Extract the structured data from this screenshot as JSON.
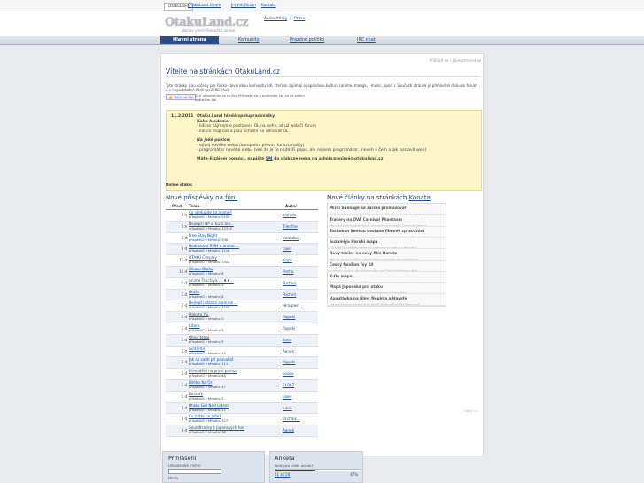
{
  "topbar": {
    "active_tab": "OtakuLand",
    "links": [
      "OtakuLand fórum",
      "Ji-rank fórum",
      "Kontakt"
    ]
  },
  "header": {
    "logo": "OtakuLand.cz",
    "tagline": "domov všech fanoušků anime",
    "links": [
      "Anime/tituly",
      "Otaku"
    ]
  },
  "nav": {
    "items": [
      "Hlavní strana",
      "Komunity",
      "Prazdné políčko",
      "IRC chat"
    ]
  },
  "toplinks": "Přihlásit se | Zaregistrovat se",
  "welcome": "Vítejte na stránkách OtakuLand.cz",
  "intro": "Tyto stránky jsou určeny pro česko-slovenskou komunitu lidí, kteří se zajímají o japonskou kulturu (anime, manga, j-music, apod.). Součástí stránek je přehledné diskusní fórum a v nepodstatné části také IRC chat.",
  "fb": {
    "button": "Tohle se líbí",
    "text": "110 uživatelům se to líbí. Přihlaste se a podívejte se, co se vašim přátelům líbí."
  },
  "notice": {
    "date": "11.2.2011",
    "heading": "Otaku.Land hledá spolupracovníky",
    "q1": "Koho hledáme:",
    "l1": [
      "- lidi se zájmem o postavení OL na nohy, ať už web či fórum",
      "- lidi co mají čas a jsou ochotní ho věnovat OL"
    ],
    "q2": "Na jaké pozice:",
    "l2": [
      "- vývoj nového webu (kompletní převod funkcionality)",
      "- programátor nového webu (vím že je to nejtěžší popis, ale nejsem programátor...nevím v čem a jak postavit web)"
    ],
    "closing_before": "Máte-li zájem pomoci, napište",
    "closing_link": "SM",
    "closing_after": "do diskuze nebo na admin@animé@otakuland.cz"
  },
  "online": "Online otaku:",
  "forum": {
    "title": "Nové příspěvky na",
    "title_link": "fóru",
    "headers": {
      "before": "Před",
      "topic": "Téma",
      "author": "Autor"
    },
    "rows": [
      {
        "n": "3 h",
        "t": "Co sledujete za anime?",
        "s": "příspěvků v tématu: 9200",
        "a": "zombie"
      },
      {
        "n": "5 h",
        "t": "Nejlepší OP & ED z ani...",
        "s": "příspěvků v tématu: 10746",
        "a": "Tiledfire"
      },
      {
        "n": "1 d",
        "t": "Free Stay Night",
        "s": "příspěvků v tématu: 936",
        "a": "Immalko"
      },
      {
        "n": "6 d",
        "t": "Hodnocení RMH a anime ...",
        "s": "příspěvků v tématu: 1216",
        "a": "pixel"
      },
      {
        "n": "11 d",
        "t": "OTAKU Cosplay",
        "s": "příspěvků v tématu: 1303",
        "a": "zippz"
      },
      {
        "n": "16 d",
        "t": "Hikaru Otaku",
        "s": "příspěvků v tématu: 6",
        "a": "Pocho"
      },
      {
        "n": "1 d",
        "t": "Anime Tsuchiya ... ♦♦...",
        "s": "příspěvků v tématu: 4",
        "a": "Pocheri"
      },
      {
        "n": "1 d",
        "t": "Otaže",
        "s": "příspěvků v tématu: 8",
        "a": "Pocheri"
      },
      {
        "n": "2 d",
        "t": "Nejlepší otázka o anime ...",
        "s": "příspěvků v tématu: 3700",
        "a": "Hiragaen"
      },
      {
        "n": "1 d",
        "t": "Makoto Yui",
        "s": "příspěvků v tématu: 0",
        "a": "Rapohi"
      },
      {
        "n": "1 d",
        "t": "Kitaro",
        "s": "příspěvků v tématu: 7",
        "a": "Rapohi"
      },
      {
        "n": "1 d",
        "t": "Otevi tema",
        "s": "příspěvků v tématu: 9",
        "a": "ilona"
      },
      {
        "n": "1 d",
        "t": "Gintama",
        "s": "příspěvků v tématu: 14",
        "a": "Aeneli"
      },
      {
        "n": "2 d",
        "t": "Jak se zaliti při pozvolně",
        "s": "příspěvků v tématu: 111",
        "a": "Rapohi"
      },
      {
        "n": "2 d",
        "t": "Převádění na první pomoc",
        "s": "příspěvků v tématu: 46",
        "a": "kosiru"
      },
      {
        "n": "1 d",
        "t": "Bílého Na Or",
        "s": "příspěvků v tématu: 47",
        "a": "El 007"
      },
      {
        "n": "1 d",
        "t": "Berserk",
        "s": "příspěvků v tématu: 3",
        "a": "pixel"
      },
      {
        "n": "3 d",
        "t": "Otaku Girl Nad Lidem",
        "s": "příspěvků v tématu: 11",
        "a": "Juera"
      },
      {
        "n": "4 d",
        "t": "Co máte na jídlo?",
        "s": "příspěvků v tématu: 3277",
        "a": "Orchais..."
      },
      {
        "n": "4 d",
        "t": "Soundtracky z japonských her",
        "s": "příspěvků v tématu: 38",
        "a": "Aeneli"
      }
    ]
  },
  "articles": {
    "title": "Nové články na stránkách",
    "title_link": "Konata",
    "items": [
      {
        "t": "Mirai Suenage se začíná promazovat",
        "e": "Pokud jste si i vy oblíbili postavu Mirai, známého maskot..."
      },
      {
        "t": "Trailery na OVA Carnival Phantasm",
        "e": "Na oficiálních stránkách pro anime projekt Carnival Phant..."
      },
      {
        "t": "Toshokan Sensou dostane filmové zpracování",
        "e": "Na čerstvém taktu od nakladatelství Hatsukawa Bunko, které..."
      },
      {
        "t": "Suzumiya Haruhi mapa",
        "e": "Co takhle udělat nějakou zajímavou kartu o Haruhi?..."
      },
      {
        "t": "Nový trailer na nový film Naruto",
        "e": "Jak už se asi tušíte, tento film navazuje na předchozí..."
      },
      {
        "t": "Český fandom foy 10",
        "e": "V rámci jarní a letošního roku se Český fandom vlezl..."
      },
      {
        "t": "K-On mapa",
        "e": "Chcete aspoň bezpečnou mapu japonska pro otaku..."
      },
      {
        "t": "Mapa Japonska pro otaku",
        "e": "Japonsko se vám líbí a zajímáte se o fanoušky..."
      },
      {
        "t": "Upoutávka na filmy Negima a Hayate",
        "e": "Na oficiálních stránkách filmů Mahou Sensei Negima!..."
      }
    ],
    "next": "další >>"
  },
  "login": {
    "title": "Přihlášení",
    "user_label": "Uživatelské jméno",
    "pass_label": "Heslo"
  },
  "poll": {
    "title": "Anketa",
    "question": "Kolik jste viděli anime?",
    "option": "11 až 50",
    "percent": "47%",
    "fill": 0.47
  }
}
